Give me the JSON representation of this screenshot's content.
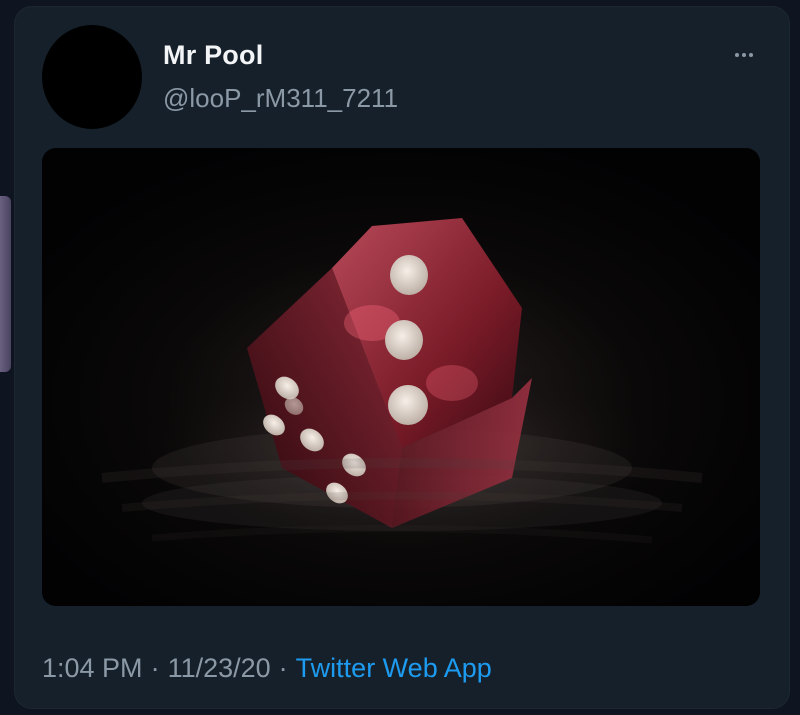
{
  "tweet": {
    "display_name": "Mr Pool",
    "handle": "@looP_rM311_7211",
    "time": "1:04 PM",
    "date": "11/23/20",
    "separator": "·",
    "source": "Twitter Web App"
  },
  "icons": {
    "more": "more-horizontal-icon"
  },
  "colors": {
    "background": "#16202b",
    "text_primary": "#f2f4f6",
    "text_secondary": "#8b99a6",
    "link": "#1d9bf0",
    "die": "#8e1f2e"
  }
}
